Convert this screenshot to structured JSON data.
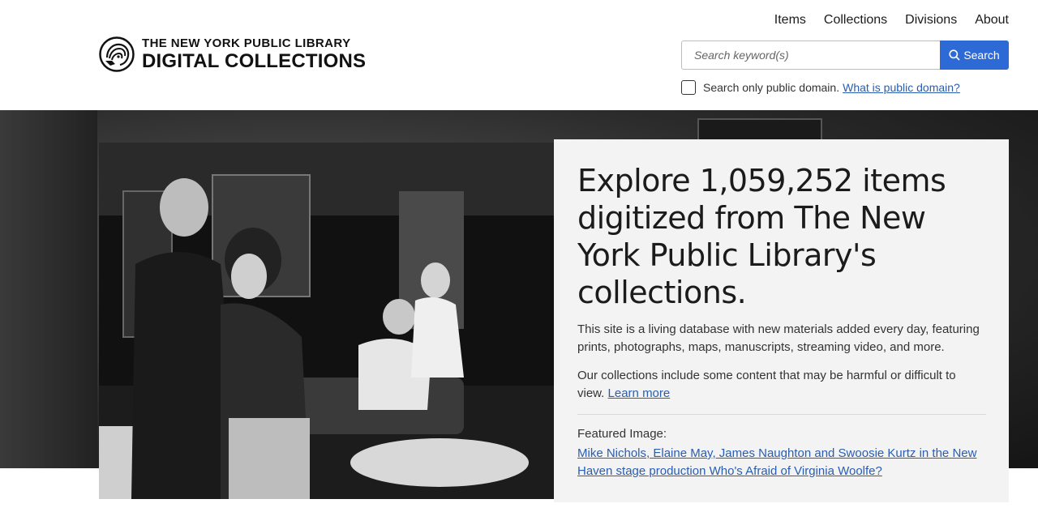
{
  "logo": {
    "line1": "THE NEW YORK PUBLIC LIBRARY",
    "line2": "DIGITAL COLLECTIONS"
  },
  "nav": {
    "items": [
      "Items",
      "Collections",
      "Divisions",
      "About"
    ]
  },
  "search": {
    "placeholder": "Search keyword(s)",
    "value": "",
    "button_label": "Search",
    "public_domain_label": "Search only public domain.",
    "public_domain_link": "What is public domain?"
  },
  "hero": {
    "headline": "Explore 1,059,252 items digitized from The New York Public Library's collections.",
    "paragraph1": "This site is a living database with new materials added every day, featuring prints, photographs, maps, manuscripts, streaming video, and more.",
    "paragraph2": "Our collections include some content that may be harmful or difficult to view.",
    "learn_more": "Learn more",
    "featured_label": "Featured Image:",
    "featured_link": "Mike Nichols, Elaine May, James Naughton and Swoosie Kurtz in the New Haven stage production Who's Afraid of Virginia Woolfe?"
  },
  "colors": {
    "accent": "#2e6ad6",
    "link": "#2a5db0",
    "card_bg": "#f3f3f3"
  },
  "icons": {
    "logo": "lion-logo-icon",
    "search": "search-icon"
  }
}
